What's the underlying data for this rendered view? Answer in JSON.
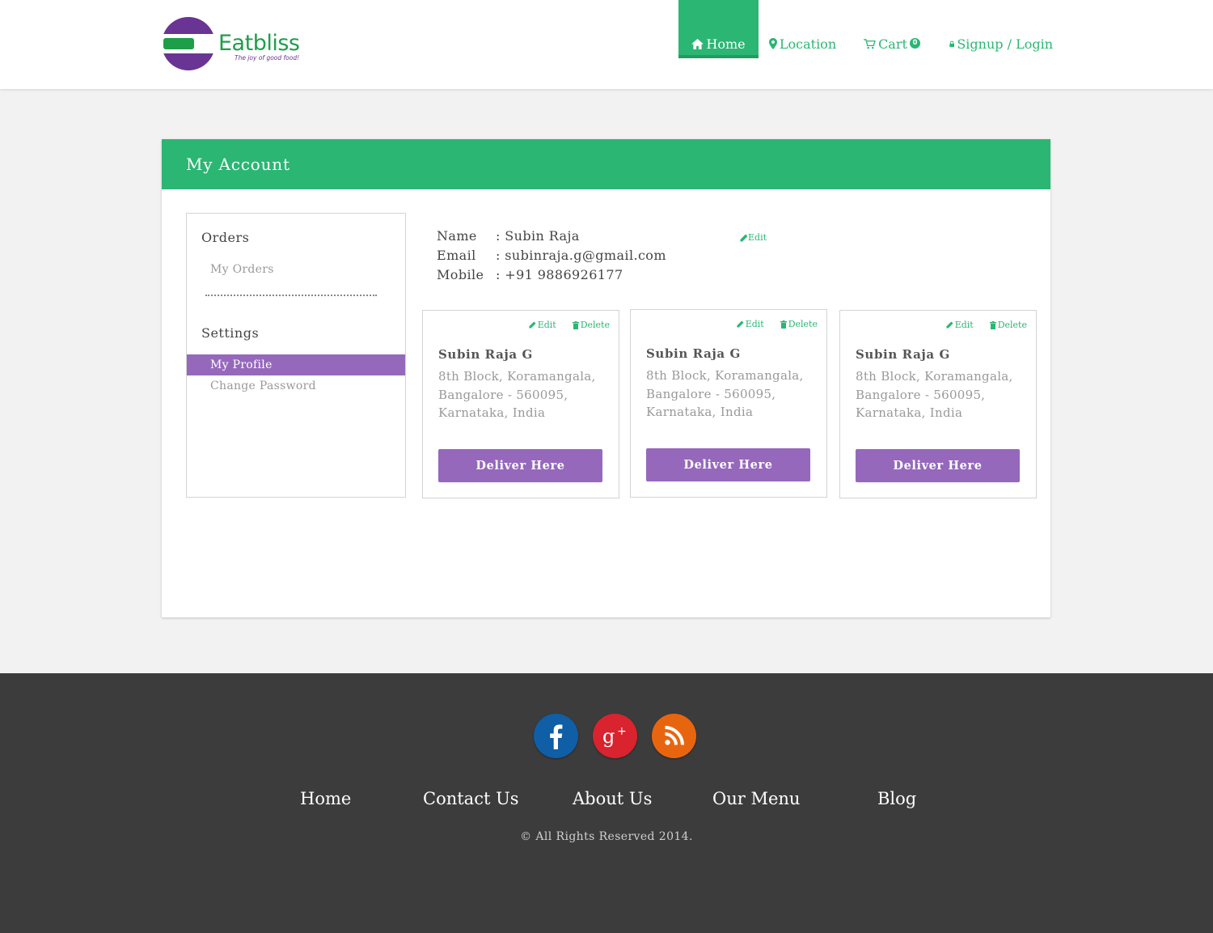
{
  "brand": {
    "name": "Eatbliss",
    "tagline": "The joy of good food!"
  },
  "nav": {
    "home": "Home",
    "location": "Location",
    "cart": "Cart",
    "cart_count": "0",
    "signup": "Signup / Login"
  },
  "account": {
    "title": "My Account",
    "sidebar": {
      "orders_heading": "Orders",
      "my_orders": "My Orders",
      "settings_heading": "Settings",
      "my_profile": "My Profile",
      "change_password": "Change Password"
    },
    "profile": {
      "name_label": "Name",
      "name_value": ": Subin Raja",
      "email_label": "Email",
      "email_value": ": subinraja.g@gmail.com",
      "mobile_label": "Mobile",
      "mobile_value": ": +91 9886926177",
      "edit_label": "Edit"
    },
    "addresses": [
      {
        "name": "Subin Raja G",
        "address": "8th Block, Koramangala, Bangalore - 560095, Karnataka, India",
        "edit": "Edit",
        "delete": "Delete",
        "button": "Deliver Here"
      },
      {
        "name": "Subin Raja G",
        "address": "8th Block, Koramangala, Bangalore - 560095, Karnataka, India",
        "edit": "Edit",
        "delete": "Delete",
        "button": "Deliver Here"
      },
      {
        "name": "Subin Raja G",
        "address": "8th Block, Koramangala, Bangalore - 560095, Karnataka, India",
        "edit": "Edit",
        "delete": "Delete",
        "button": "Deliver Here"
      }
    ]
  },
  "footer": {
    "links": [
      "Home",
      "Contact Us",
      "About Us",
      "Our Menu",
      "Blog"
    ],
    "copyright": "© All Rights Reserved 2014."
  },
  "colors": {
    "green": "#2bb673",
    "purple": "#9668bc",
    "footer": "#3c3c3c"
  }
}
